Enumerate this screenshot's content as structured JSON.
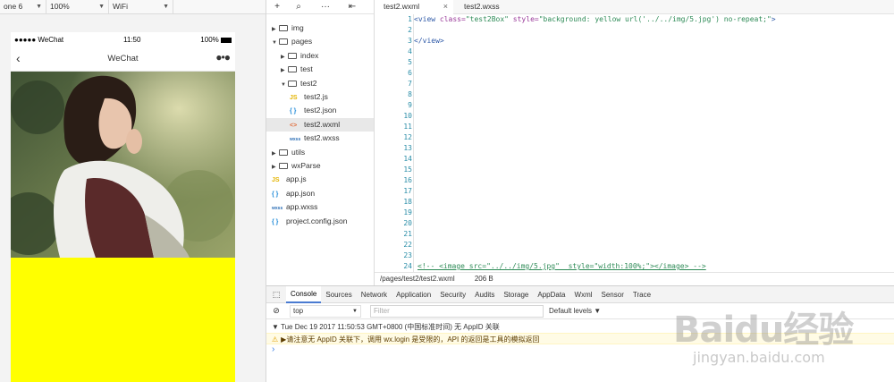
{
  "simulator": {
    "device": "one 6",
    "zoom": "100%",
    "network": "WiFi",
    "status_carrier": "●●●●● WeChat",
    "status_time": "11:50",
    "status_battery": "100%",
    "nav_title": "WeChat",
    "box_bg_color": "#ffff00"
  },
  "tree": {
    "items": [
      {
        "label": "img",
        "type": "folder",
        "open": false,
        "depth": 0
      },
      {
        "label": "pages",
        "type": "folder",
        "open": true,
        "depth": 0
      },
      {
        "label": "index",
        "type": "folder",
        "open": false,
        "depth": 1
      },
      {
        "label": "test",
        "type": "folder",
        "open": false,
        "depth": 1
      },
      {
        "label": "test2",
        "type": "folder",
        "open": true,
        "depth": 1
      },
      {
        "label": "test2.js",
        "type": "js",
        "depth": 2
      },
      {
        "label": "test2.json",
        "type": "json",
        "depth": 2
      },
      {
        "label": "test2.wxml",
        "type": "wxml",
        "depth": 2,
        "selected": true
      },
      {
        "label": "test2.wxss",
        "type": "wxss",
        "depth": 2
      },
      {
        "label": "utils",
        "type": "folder",
        "open": false,
        "depth": 0
      },
      {
        "label": "wxParse",
        "type": "folder",
        "open": false,
        "depth": 0
      },
      {
        "label": "app.js",
        "type": "js",
        "depth": 0
      },
      {
        "label": "app.json",
        "type": "json",
        "depth": 0
      },
      {
        "label": "app.wxss",
        "type": "wxss",
        "depth": 0
      },
      {
        "label": "project.config.json",
        "type": "json",
        "depth": 0
      }
    ],
    "icon_text": {
      "js": "JS",
      "json": "{ }",
      "wxml": "<>",
      "wxss": "wxss"
    }
  },
  "editor": {
    "tabs": [
      {
        "label": "test2.wxml",
        "active": true
      },
      {
        "label": "test2.wxss",
        "active": false
      }
    ],
    "line_numbers": [
      "1",
      "2",
      "3",
      "4",
      "5",
      "6",
      "7",
      "8",
      "9",
      "10",
      "11",
      "12",
      "13",
      "14",
      "15",
      "16",
      "17",
      "18",
      "19",
      "20",
      "21",
      "22",
      "23",
      "24"
    ],
    "line1": {
      "open": "<view ",
      "attr1": "class=",
      "val1": "\"test2Box\"",
      "attr2": " style=",
      "val2": "\"background: yellow url('../../img/5.jpg') no-repeat;\"",
      "close": ">"
    },
    "line3": "</view>",
    "line24": "<!-- <image src=\"../../img/5.jpg\"  style=\"width:100%;\"></image> -->",
    "file_path": "/pages/test2/test2.wxml",
    "file_size": "206 B"
  },
  "console": {
    "tabs": [
      "Console",
      "Sources",
      "Network",
      "Application",
      "Security",
      "Audits",
      "Storage",
      "AppData",
      "Wxml",
      "Sensor",
      "Trace"
    ],
    "active_tab": "Console",
    "context": "top",
    "filter_placeholder": "Filter",
    "levels": "Default levels ▼",
    "log_group": "▼ Tue Dec 19 2017 11:50:53 GMT+0800 (中国标准时间) 无 AppID 关联",
    "warning": "▶请注意无 AppID 关联下，调用 wx.login 是受限的，API 的返回是工具的模拟返回",
    "prompt": "›"
  },
  "watermark": {
    "logo": "Baidu经验",
    "url": "jingyan.baidu.com"
  }
}
